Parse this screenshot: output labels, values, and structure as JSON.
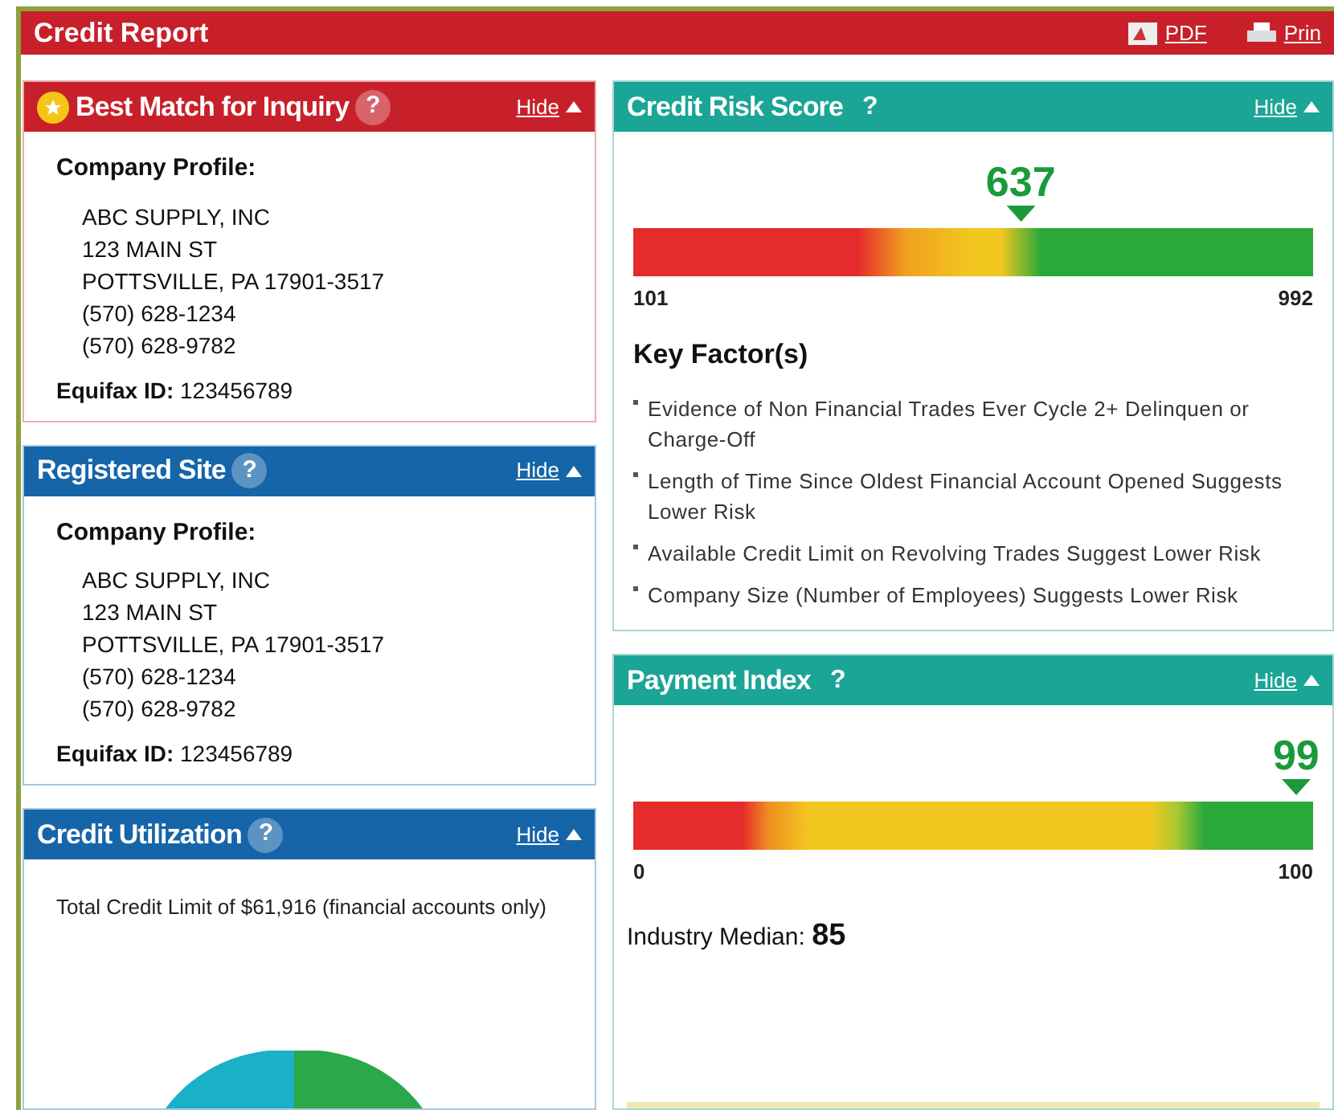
{
  "header": {
    "title": "Credit Report",
    "actions": [
      {
        "kind": "pdf",
        "label": "PDF"
      },
      {
        "kind": "print",
        "label": "Prin"
      }
    ]
  },
  "left_panels": [
    {
      "title": "Best Match for Inquiry",
      "color": "#c8202a",
      "star": true,
      "help": "?",
      "hide": "Hide",
      "kind": "profile",
      "heading": "Company Profile:",
      "lines": [
        "ABC SUPPLY, INC",
        "123 MAIN ST",
        "POTTSVILLE, PA 17901-3517",
        "(570) 628-1234",
        "(570) 628-9782"
      ],
      "id_label": "Equifax ID:",
      "id_value": "123456789"
    },
    {
      "title": "Registered Site",
      "color": "#1565a8",
      "star": false,
      "help": "?",
      "hide": "Hide",
      "kind": "profile",
      "heading": "Company Profile:",
      "lines": [
        "ABC SUPPLY, INC",
        "123 MAIN ST",
        "POTTSVILLE, PA 17901-3517",
        "(570) 628-1234",
        "(570) 628-9782"
      ],
      "id_label": "Equifax ID:",
      "id_value": "123456789"
    },
    {
      "title": "Credit Utilization",
      "color": "#1565a8",
      "star": false,
      "help": "?",
      "hide": "Hide",
      "kind": "utilization",
      "text": "Total Credit Limit of $61,916 (financial accounts only)"
    }
  ],
  "right_panels": [
    {
      "title": "Credit Risk Score",
      "color": "#1aa596",
      "help": "?",
      "hide": "Hide",
      "score": "637",
      "level": 0.57,
      "min": "101",
      "max": "992",
      "kind": "risk",
      "factors_title": "Key Factor(s)",
      "factors": [
        "Evidence of Non Financial Trades Ever Cycle 2+ Delinquen or Charge-Off",
        "Length of Time Since Oldest Financial Account Opened Suggests Lower Risk",
        "Available Credit Limit on Revolving Trades Suggest Lower Risk",
        "Company Size (Number of Employees) Suggests Lower Risk"
      ]
    },
    {
      "title": "Payment Index",
      "color": "#1aa596",
      "help": "?",
      "hide": "Hide",
      "score": "99",
      "level": 0.975,
      "min": "0",
      "max": "100",
      "kind": "payment",
      "median_label": "Industry Median:",
      "median_value": "85"
    }
  ]
}
